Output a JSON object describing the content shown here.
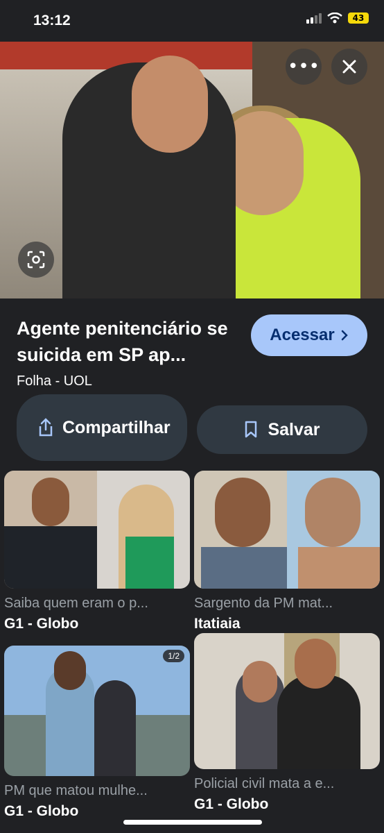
{
  "status_bar": {
    "time": "13:12",
    "battery": "43"
  },
  "hero": {
    "alt_description": ""
  },
  "result": {
    "title": "Agente penitenciário se suicida em SP ap...",
    "source": "Folha - UOL",
    "visit_label": "Acessar",
    "share_label": "Compartilhar",
    "save_label": "Salvar"
  },
  "related": [
    {
      "title": "Saiba quem eram o p...",
      "source": "G1 - Globo",
      "badge": ""
    },
    {
      "title": "Sargento da PM mat...",
      "source": "Itatiaia",
      "badge": ""
    },
    {
      "title": "PM que matou mulhe...",
      "source": "G1 - Globo",
      "badge": "1/2"
    },
    {
      "title": "Policial civil mata a e...",
      "source": "G1 - Globo",
      "badge": ""
    }
  ],
  "colors": {
    "background": "#202124",
    "accent": "#a8c7fa",
    "pill": "#303942"
  },
  "icons": [
    "more-horizontal-icon",
    "close-icon",
    "lens-icon",
    "share-icon",
    "bookmark-icon",
    "chevron-right-icon"
  ]
}
